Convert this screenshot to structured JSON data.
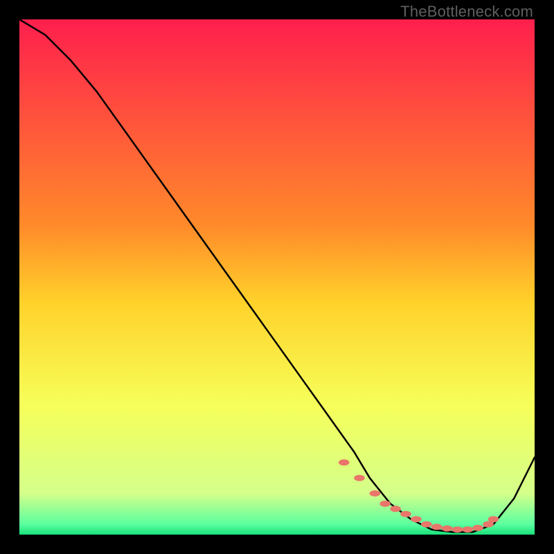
{
  "attribution": "TheBottleneck.com",
  "chart_data": {
    "type": "line",
    "title": "",
    "xlabel": "",
    "ylabel": "",
    "xlim": [
      0,
      100
    ],
    "ylim": [
      0,
      100
    ],
    "grid": false,
    "background_gradient": {
      "stops": [
        {
          "y": 100,
          "color": "#ff1f4d"
        },
        {
          "y": 60,
          "color": "#ff8a2a"
        },
        {
          "y": 45,
          "color": "#ffd22a"
        },
        {
          "y": 25,
          "color": "#f6ff5a"
        },
        {
          "y": 8,
          "color": "#d4ff8a"
        },
        {
          "y": 2,
          "color": "#5bffa0"
        },
        {
          "y": 0,
          "color": "#19e07a"
        }
      ]
    },
    "series": [
      {
        "name": "bottleneck_curve",
        "color": "#000000",
        "x": [
          0,
          5,
          10,
          15,
          20,
          25,
          30,
          35,
          40,
          45,
          50,
          55,
          60,
          65,
          68,
          72,
          76,
          80,
          84,
          88,
          92,
          96,
          100
        ],
        "y": [
          100,
          97,
          92,
          86,
          79,
          72,
          65,
          58,
          51,
          44,
          37,
          30,
          23,
          16,
          11,
          6,
          3,
          1,
          0.5,
          0.5,
          2,
          7,
          15
        ]
      }
    ],
    "markers": {
      "name": "highlight_dots",
      "color": "#e9766a",
      "radius_px": 6,
      "x": [
        63,
        66,
        69,
        71,
        73,
        75,
        77,
        79,
        81,
        83,
        85,
        87,
        89,
        91,
        92
      ],
      "y": [
        14,
        11,
        8,
        6,
        5,
        4,
        3,
        2,
        1.5,
        1.2,
        1,
        1,
        1.3,
        2,
        3
      ]
    }
  }
}
